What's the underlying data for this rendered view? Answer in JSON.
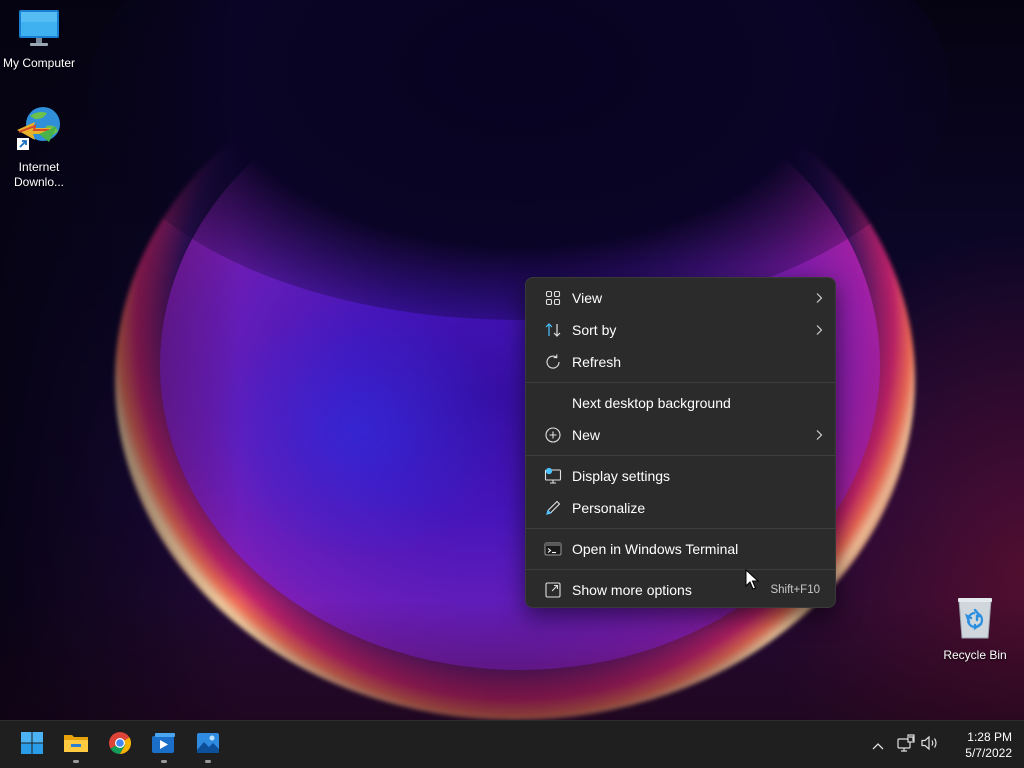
{
  "desktop": {
    "icons": [
      {
        "label": "My Computer",
        "icon": "monitor-icon"
      },
      {
        "label_line1": "Internet",
        "label_line2": "Downlo...",
        "icon": "internet-download-manager-icon"
      },
      {
        "label": "Recycle Bin",
        "icon": "recycle-bin-icon"
      }
    ]
  },
  "context_menu": {
    "items": [
      {
        "label": "View",
        "icon": "grid-view-icon",
        "has_submenu": true
      },
      {
        "label": "Sort by",
        "icon": "sort-arrows-icon",
        "has_submenu": true
      },
      {
        "label": "Refresh",
        "icon": "refresh-icon",
        "has_submenu": false
      },
      {
        "label": "Next desktop background",
        "icon": "",
        "has_submenu": false
      },
      {
        "label": "New",
        "icon": "plus-circle-icon",
        "has_submenu": true
      },
      {
        "label": "Display settings",
        "icon": "display-settings-icon",
        "has_submenu": false
      },
      {
        "label": "Personalize",
        "icon": "pen-icon",
        "has_submenu": false
      },
      {
        "label": "Open in Windows Terminal",
        "icon": "terminal-icon",
        "has_submenu": false
      },
      {
        "label": "Show more options",
        "icon": "external-window-icon",
        "has_submenu": false,
        "shortcut": "Shift+F10"
      }
    ]
  },
  "taskbar": {
    "apps": [
      "start-icon",
      "file-explorer-icon",
      "chrome-icon",
      "media-player-icon",
      "photos-icon"
    ],
    "tray": {
      "time": "1:28 PM",
      "date": "5/7/2022"
    }
  },
  "colors": {
    "menu_bg": "#2b2b2b",
    "taskbar_bg": "#1f1f20",
    "accent_blue": "#4cc2ff"
  }
}
